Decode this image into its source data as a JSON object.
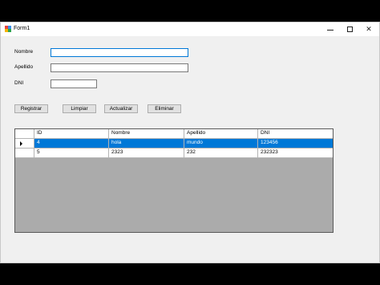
{
  "window": {
    "title": "Form1",
    "minimize": "—",
    "close": "✕"
  },
  "colors": {
    "selection": "#0078d7",
    "grid_background": "#ababab",
    "form_background": "#f0f0f0"
  },
  "form": {
    "nombre_label": "Nombre",
    "apellido_label": "Apellido",
    "dni_label": "DNI",
    "nombre_value": "",
    "apellido_value": "",
    "dni_value": ""
  },
  "buttons": {
    "registrar": "Registrar",
    "limpiar": "Limpiar",
    "actualizar": "Actualizar",
    "eliminar": "Eliminar"
  },
  "grid": {
    "columns": [
      "ID",
      "Nombre",
      "Apellido",
      "DNI"
    ],
    "rows": [
      {
        "id": "4",
        "nombre": "hola",
        "apellido": "mundo",
        "dni": "123456",
        "selected": true
      },
      {
        "id": "5",
        "nombre": "2323",
        "apellido": "232",
        "dni": "232323",
        "selected": false
      }
    ]
  }
}
